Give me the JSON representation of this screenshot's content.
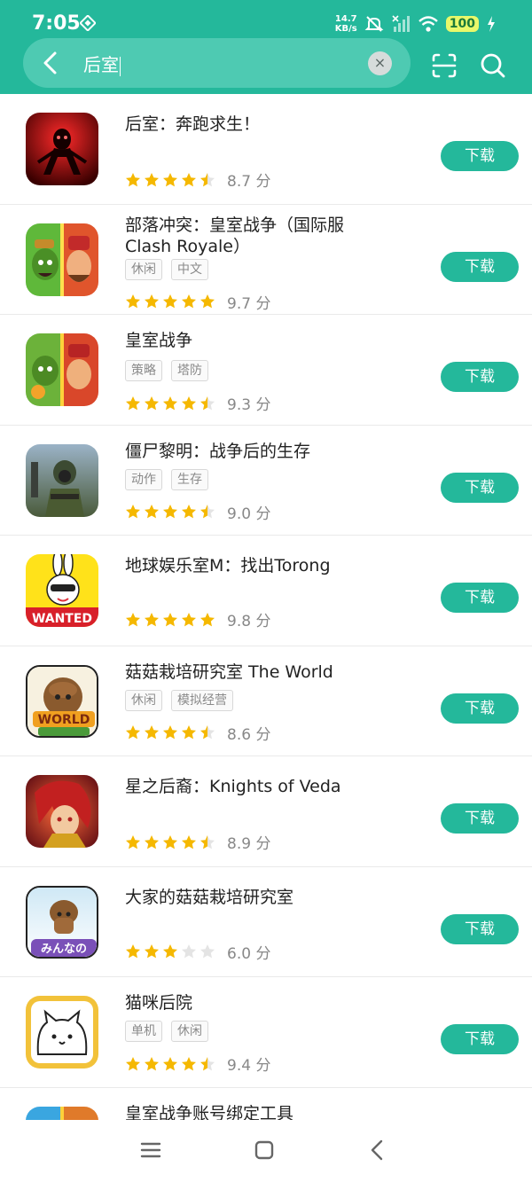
{
  "status_bar": {
    "time": "7:05",
    "net_speed_value": "14.7",
    "net_speed_unit": "KB/s",
    "battery": "100"
  },
  "search": {
    "query": "后室",
    "clear_icon": "close-icon"
  },
  "colors": {
    "brand": "#24b89b",
    "star_on": "#f5b800",
    "star_off": "#e4e4e4"
  },
  "apps": [
    {
      "title": "后室：奔跑求生！",
      "tags": [],
      "stars": 4.5,
      "score": "8.7 分",
      "button": "下载"
    },
    {
      "title": "部落冲突：皇室战争（国际服 Clash Royale）",
      "tags": [
        "休闲",
        "中文"
      ],
      "stars": 5,
      "score": "9.7 分",
      "button": "下载"
    },
    {
      "title": "皇室战争",
      "tags": [
        "策略",
        "塔防"
      ],
      "stars": 4.5,
      "score": "9.3 分",
      "button": "下载"
    },
    {
      "title": "僵尸黎明：战争后的生存",
      "tags": [
        "动作",
        "生存"
      ],
      "stars": 4.5,
      "score": "9.0 分",
      "button": "下载"
    },
    {
      "title": "地球娱乐室M：找出Torong",
      "tags": [],
      "stars": 5,
      "score": "9.8 分",
      "button": "下载"
    },
    {
      "title": "菇菇栽培研究室 The World",
      "tags": [
        "休闲",
        "模拟经营"
      ],
      "stars": 4.5,
      "score": "8.6 分",
      "button": "下载"
    },
    {
      "title": "星之后裔：Knights of Veda",
      "tags": [],
      "stars": 4.5,
      "score": "8.9 分",
      "button": "下载"
    },
    {
      "title": "大家的菇菇栽培研究室",
      "tags": [],
      "stars": 3,
      "score": "6.0 分",
      "button": "下载"
    },
    {
      "title": "猫咪后院",
      "tags": [
        "单机",
        "休闲"
      ],
      "stars": 4.5,
      "score": "9.4 分",
      "button": "下载"
    },
    {
      "title": "皇室战争账号绑定工具",
      "tags": [],
      "stars": 0,
      "score": "",
      "button": ""
    }
  ]
}
